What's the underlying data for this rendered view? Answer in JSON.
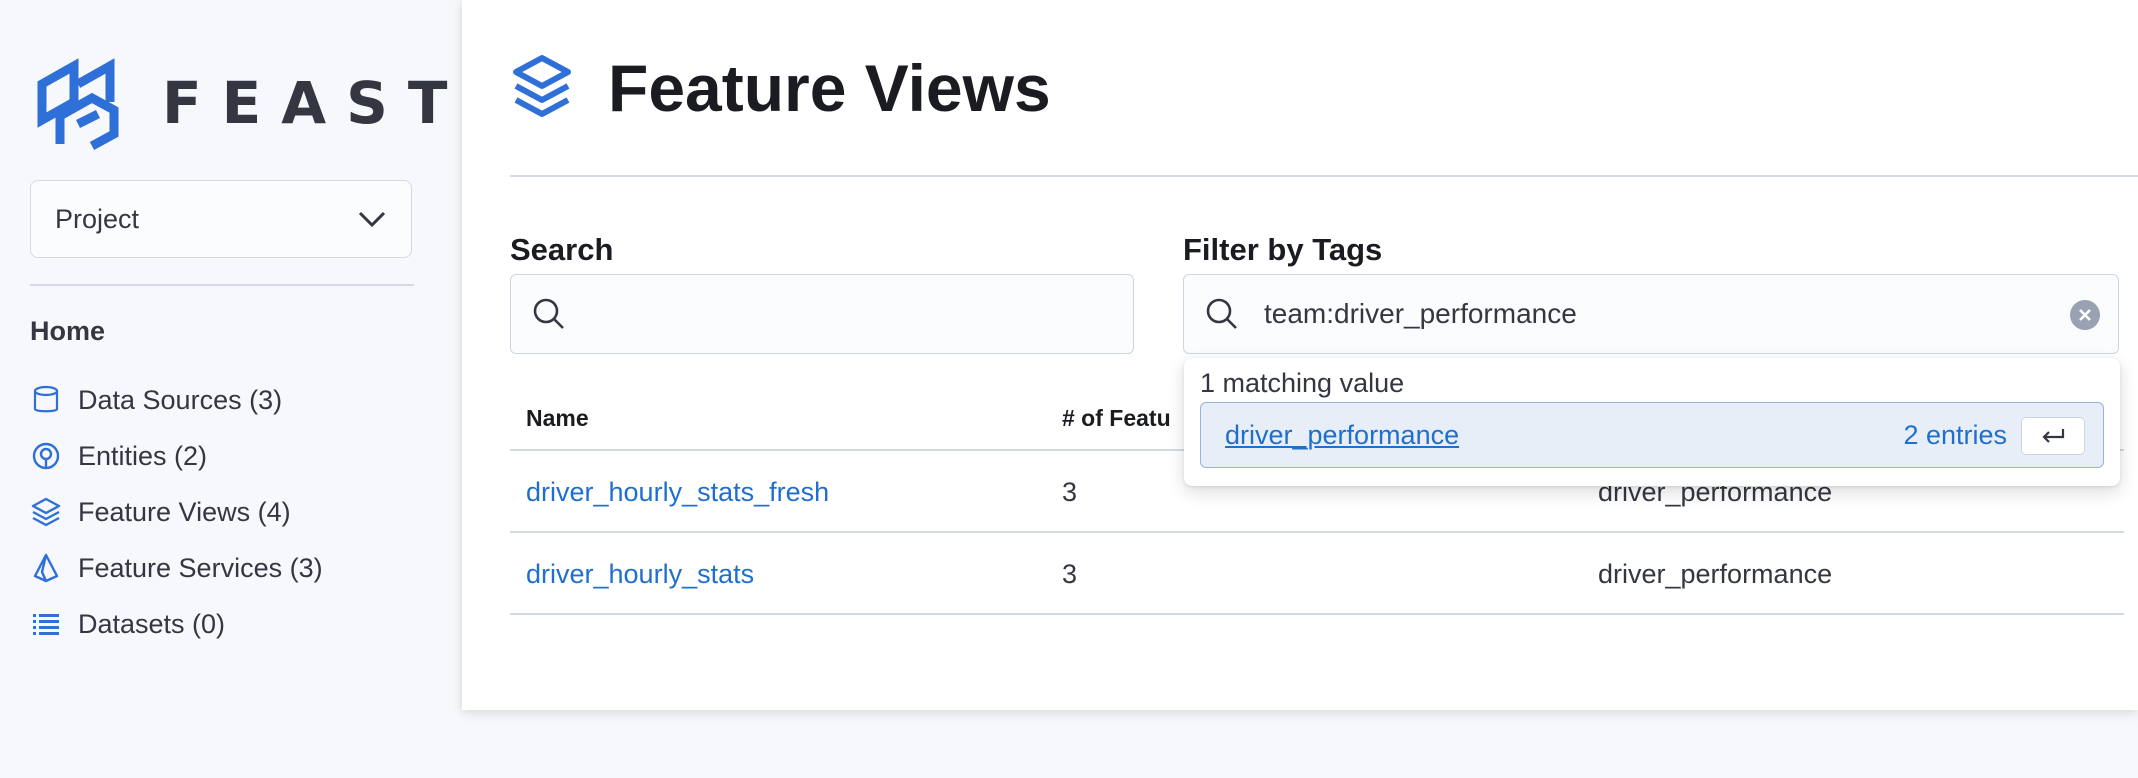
{
  "app": {
    "name": "FEAST"
  },
  "sidebar": {
    "project_select": {
      "label": "Project"
    },
    "home_label": "Home",
    "items": [
      {
        "label": "Data Sources (3)",
        "icon": "database-icon"
      },
      {
        "label": "Entities (2)",
        "icon": "target-icon"
      },
      {
        "label": "Feature Views (4)",
        "icon": "layers-icon"
      },
      {
        "label": "Feature Services (3)",
        "icon": "service-icon"
      },
      {
        "label": "Datasets (0)",
        "icon": "list-icon"
      }
    ]
  },
  "page": {
    "title": "Feature Views",
    "search": {
      "label": "Search",
      "value": ""
    },
    "tag_filter": {
      "label": "Filter by Tags",
      "value": "team:driver_performance"
    },
    "table": {
      "columns": [
        "Name",
        "# of Featu",
        ""
      ],
      "rows": [
        {
          "name": "driver_hourly_stats_fresh",
          "features": "3",
          "tag": "driver_performance"
        },
        {
          "name": "driver_hourly_stats",
          "features": "3",
          "tag": "driver_performance"
        }
      ]
    },
    "suggestions": {
      "count_text": "1 matching value",
      "options": [
        {
          "label": "driver_performance",
          "entries": "2 entries"
        }
      ]
    }
  },
  "colors": {
    "accent": "#1f6fcf",
    "logo": "#2e6fd8",
    "text": "#343741"
  }
}
